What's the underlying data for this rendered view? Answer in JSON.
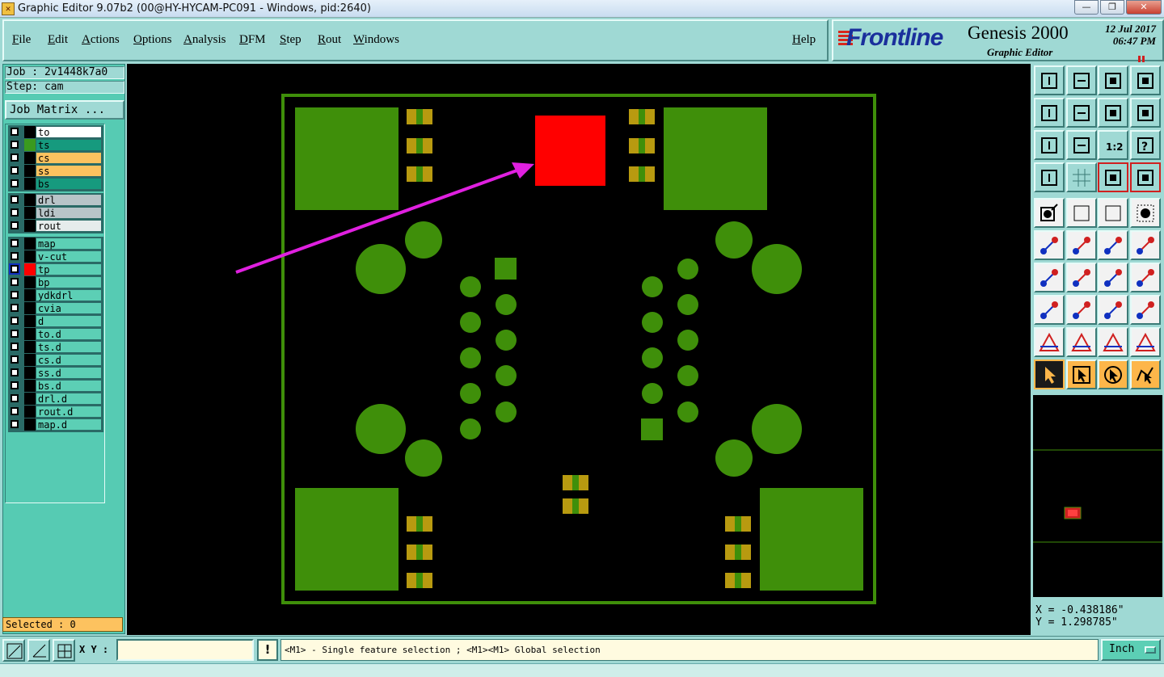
{
  "window": {
    "title": "Graphic Editor 9.07b2 (00@HY-HYCAM-PC091 - Windows, pid:2640)",
    "minimize": "—",
    "restore": "❐",
    "close": "✕"
  },
  "menu": {
    "items": [
      "File",
      "Edit",
      "Actions",
      "Options",
      "Analysis",
      "DFM",
      "Step",
      "Rout",
      "Windows"
    ],
    "help": "Help"
  },
  "branding": {
    "company": "Frontline",
    "product": "Genesis 2000",
    "subtitle": "Graphic Editor",
    "date": "12 Jul 2017",
    "time": "06:47 PM"
  },
  "job": {
    "job_label": "Job : 2v1448k7a0",
    "step_label": "Step: cam",
    "matrix_button": "Job Matrix ..."
  },
  "layers": {
    "board": [
      {
        "name": "to",
        "color": "#ffffff",
        "swatch": "#000000"
      },
      {
        "name": "ts",
        "color": "#169a7e",
        "swatch": "#3a9a1e"
      },
      {
        "name": "cs",
        "color": "#fdc25f",
        "swatch": "#000000"
      },
      {
        "name": "ss",
        "color": "#fdc25f",
        "swatch": "#000000"
      },
      {
        "name": "bs",
        "color": "#169a7e",
        "swatch": "#000000"
      }
    ],
    "drill": [
      {
        "name": "drl",
        "color": "#b8c4c8",
        "swatch": "#000000"
      },
      {
        "name": "ldi",
        "color": "#b8c4c8",
        "swatch": "#000000"
      },
      {
        "name": "rout",
        "color": "#e6ecec",
        "swatch": "#000000"
      }
    ],
    "misc": [
      {
        "name": "map",
        "color": "#5ccfb5",
        "swatch": "#000000"
      },
      {
        "name": "v-cut",
        "color": "#5ccfb5",
        "swatch": "#000000"
      },
      {
        "name": "tp",
        "color": "#5ccfb5",
        "swatch": "#ff0000",
        "active": true
      },
      {
        "name": "bp",
        "color": "#5ccfb5",
        "swatch": "#000000"
      },
      {
        "name": "ydkdrl",
        "color": "#5ccfb5",
        "swatch": "#000000"
      },
      {
        "name": "cvia",
        "color": "#5ccfb5",
        "swatch": "#000000"
      },
      {
        "name": "d",
        "color": "#5ccfb5",
        "swatch": "#000000"
      },
      {
        "name": "to.d",
        "color": "#5ccfb5",
        "swatch": "#000000"
      },
      {
        "name": "ts.d",
        "color": "#5ccfb5",
        "swatch": "#000000"
      },
      {
        "name": "cs.d",
        "color": "#5ccfb5",
        "swatch": "#000000"
      },
      {
        "name": "ss.d",
        "color": "#5ccfb5",
        "swatch": "#000000"
      },
      {
        "name": "bs.d",
        "color": "#5ccfb5",
        "swatch": "#000000"
      },
      {
        "name": "drl.d",
        "color": "#5ccfb5",
        "swatch": "#000000"
      },
      {
        "name": "rout.d",
        "color": "#5ccfb5",
        "swatch": "#000000"
      },
      {
        "name": "map.d",
        "color": "#5ccfb5",
        "swatch": "#000000"
      }
    ]
  },
  "selection": {
    "label": "Selected : 0"
  },
  "coordinates": {
    "x": "X = -0.438186\"",
    "y": "Y = 1.298785\""
  },
  "bottom": {
    "xy_label": "X Y :",
    "xy_value": "",
    "warn": "!",
    "hint": "<M1> - Single feature selection ; <M1><M1> Global selection",
    "units": "Inch"
  },
  "colors": {
    "panel": "#9fd9d4",
    "layer_panel": "#56cbb3",
    "pad_green": "#3f8f0a",
    "smd_gold": "#b89a10",
    "highlight_red": "#ff0000",
    "annotation_magenta": "#e020e0"
  },
  "toolbar_icons": [
    "layer-up-icon",
    "layer-down-icon",
    "home-icon",
    "window-icon",
    "pan-left-icon",
    "pan-right-icon",
    "swap-icon",
    "snake-icon",
    "zoom-fit-icon",
    "zoom-center-icon",
    "scale-1-2-icon",
    "help-icon",
    "settings-icon",
    "grid-icon",
    "graphics-a-icon",
    "graphics-b-icon",
    "pad-icon",
    "line-icon",
    "ruler-icon",
    "dot-icon",
    "connect-icon",
    "cross-icon",
    "arc-icon",
    "arc2-icon",
    "angle-icon",
    "slash-icon",
    "rotate-icon",
    "mirror-icon",
    "copy-icon",
    "cut-icon",
    "measure-icon",
    "group-icon",
    "triangle-icon",
    "triangle-up-icon",
    "triangle-a-icon",
    "triangle-b-icon",
    "select-arrow-icon",
    "select-box-icon",
    "select-circle-icon",
    "select-path-icon"
  ]
}
